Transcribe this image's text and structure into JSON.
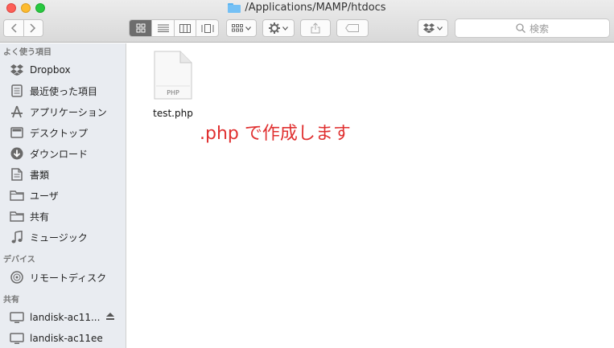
{
  "window": {
    "title": "/Applications/MAMP/htdocs"
  },
  "toolbar": {
    "back_icon": "chevron-left-icon",
    "forward_icon": "chevron-right-icon",
    "search_placeholder": "検索"
  },
  "sidebar": {
    "sections": [
      {
        "header": "よく使う項目",
        "items": [
          {
            "label": "Dropbox",
            "icon": "dropbox-icon"
          },
          {
            "label": "最近使った項目",
            "icon": "recents-icon"
          },
          {
            "label": "アプリケーション",
            "icon": "applications-icon"
          },
          {
            "label": "デスクトップ",
            "icon": "desktop-icon"
          },
          {
            "label": "ダウンロード",
            "icon": "downloads-icon"
          },
          {
            "label": "書類",
            "icon": "documents-icon"
          },
          {
            "label": "ユーザ",
            "icon": "folder-icon"
          },
          {
            "label": "共有",
            "icon": "folder-icon"
          },
          {
            "label": "ミュージック",
            "icon": "music-icon"
          }
        ]
      },
      {
        "header": "デバイス",
        "items": [
          {
            "label": "リモートディスク",
            "icon": "remote-disc-icon"
          }
        ]
      },
      {
        "header": "共有",
        "items": [
          {
            "label": "landisk-ac11...",
            "icon": "network-computer-icon"
          },
          {
            "label": "landisk-ac11ee",
            "icon": "network-computer-icon"
          }
        ]
      }
    ]
  },
  "content": {
    "file": {
      "name": "test.php",
      "type_label": "PHP"
    },
    "annotation": ".php で作成します"
  }
}
